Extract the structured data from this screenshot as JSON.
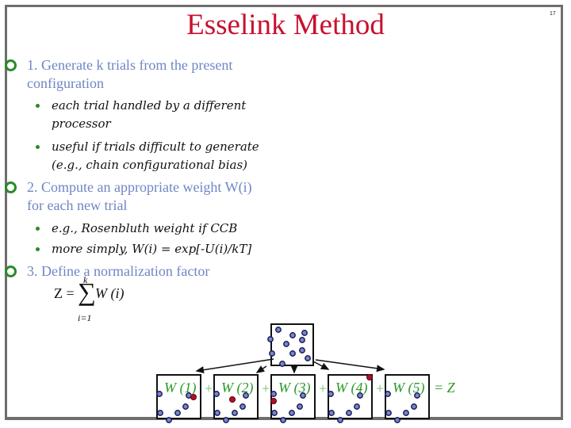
{
  "slide": {
    "title": "Esselink Method",
    "number": "17"
  },
  "bullets": [
    {
      "text_line1": "1. Generate k trials from the present",
      "text_line2": "configuration",
      "sub": [
        {
          "line1": "each trial handled by a different",
          "line2": "processor"
        },
        {
          "line1": "useful if trials difficult to generate",
          "line2": "(e.g., chain configurational bias)"
        }
      ]
    },
    {
      "text_line1": "2. Compute an appropriate weight W(i)",
      "text_line2": "for each new trial",
      "sub": [
        {
          "line1": "e.g., Rosenbluth weight if CCB"
        },
        {
          "line1": "more simply, W(i) = exp[-U(i)/kT]"
        }
      ]
    },
    {
      "text_line1": "3. Define a normalization factor"
    }
  ],
  "equation": {
    "lhs": "Z =",
    "sigma": "∑",
    "upper": "k",
    "lower": "i=1",
    "rhs": "W (i)"
  },
  "diagram": {
    "weights": [
      "W (1)",
      "W (2)",
      "W (3)",
      "W (4)",
      "W (5)"
    ],
    "plus": "+",
    "result": "= Z",
    "colors": {
      "particle": "#7a86c8",
      "particle_outline": "#1a1f5a",
      "new_particle": "#b0102a",
      "label": "#2a9a2a",
      "ring": "#2a8a2a",
      "title": "#c8102e",
      "text": "#6f86c4"
    }
  }
}
